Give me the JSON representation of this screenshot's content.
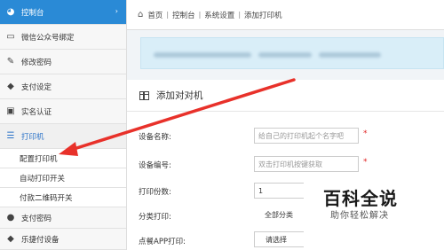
{
  "sidebar": {
    "items": [
      {
        "label": "控制台",
        "icon": "dashboard-icon",
        "glyph": "◕"
      },
      {
        "label": "微信公众号绑定",
        "icon": "monitor-icon",
        "glyph": "▭"
      },
      {
        "label": "修改密码",
        "icon": "edit-icon",
        "glyph": "✎"
      },
      {
        "label": "支付设定",
        "icon": "tag-icon",
        "glyph": "◆"
      },
      {
        "label": "实名认证",
        "icon": "id-card-icon",
        "glyph": "▣"
      },
      {
        "label": "打印机",
        "icon": "list-icon",
        "glyph": "☰"
      },
      {
        "label": "配置打印机"
      },
      {
        "label": "自动打印开关"
      },
      {
        "label": "付款二维码开关"
      },
      {
        "label": "支付密码",
        "icon": "user-icon",
        "glyph": "●"
      },
      {
        "label": "乐捷付设备",
        "icon": "tag-icon",
        "glyph": "◆"
      }
    ]
  },
  "breadcrumb": {
    "items": [
      "首页",
      "控制台",
      "系统设置",
      "添加打印机"
    ]
  },
  "panel": {
    "title": "添加对对机"
  },
  "form": {
    "device_name": {
      "label": "设备名称:",
      "placeholder": "给自己的打印机起个名字吧"
    },
    "device_number": {
      "label": "设备编号:",
      "placeholder": "双击打印机按键获取"
    },
    "copies": {
      "label": "打印份数:",
      "value": "1"
    },
    "category": {
      "label": "分类打印:",
      "value": "全部分类"
    },
    "app_print": {
      "label": "点餐APP打印:",
      "value": "请选择"
    }
  },
  "watermark": {
    "title": "百科全说",
    "subtitle": "助你轻松解决"
  },
  "colors": {
    "accent": "#2a8ad6",
    "required": "#e02020",
    "annotation_arrow": "#e8312a"
  }
}
